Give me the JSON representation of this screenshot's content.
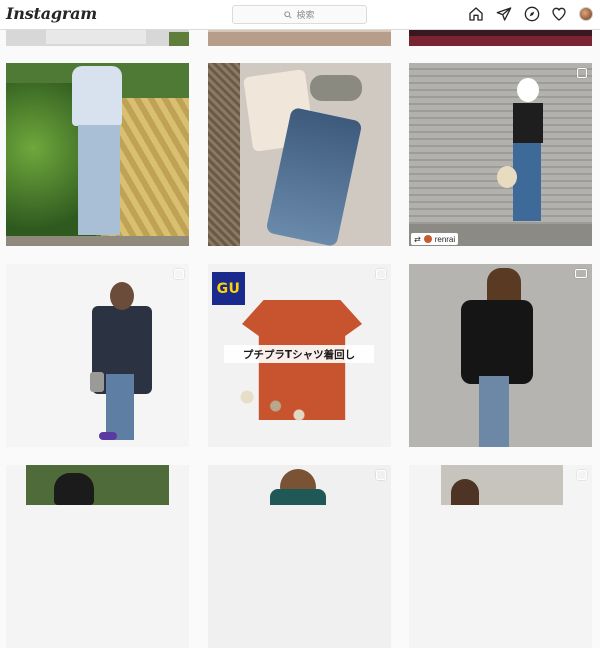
{
  "header": {
    "logo_text": "Instagram",
    "search": {
      "placeholder": "検索",
      "icon": "search-icon"
    },
    "nav_icons": [
      "home-icon",
      "direct-icon",
      "explore-icon",
      "heart-icon"
    ],
    "avatar": "profile-avatar"
  },
  "grid": {
    "tiles": [
      {
        "id": "r0c0",
        "kind": "photo"
      },
      {
        "id": "r0c1",
        "kind": "photo"
      },
      {
        "id": "r0c2",
        "kind": "photo"
      },
      {
        "id": "r1c0",
        "kind": "photo",
        "multi": false
      },
      {
        "id": "r1c1",
        "kind": "photo",
        "multi": false
      },
      {
        "id": "r1c2",
        "kind": "carousel",
        "repost_badge": {
          "username": "renrai"
        }
      },
      {
        "id": "r2c0",
        "kind": "carousel"
      },
      {
        "id": "r2c1",
        "kind": "carousel",
        "logo": "GU",
        "caption": "プチプラTシャツ着回し"
      },
      {
        "id": "r2c2",
        "kind": "video"
      },
      {
        "id": "r3c0",
        "kind": "photo"
      },
      {
        "id": "r3c1",
        "kind": "carousel"
      },
      {
        "id": "r3c2",
        "kind": "carousel"
      }
    ]
  },
  "colors": {
    "background": "#fafafa",
    "header_border": "#dbdbdb",
    "text": "#262626",
    "muted": "#8e8e8e",
    "gu_blue": "#1a2a8c",
    "gu_yellow": "#ffd400"
  }
}
